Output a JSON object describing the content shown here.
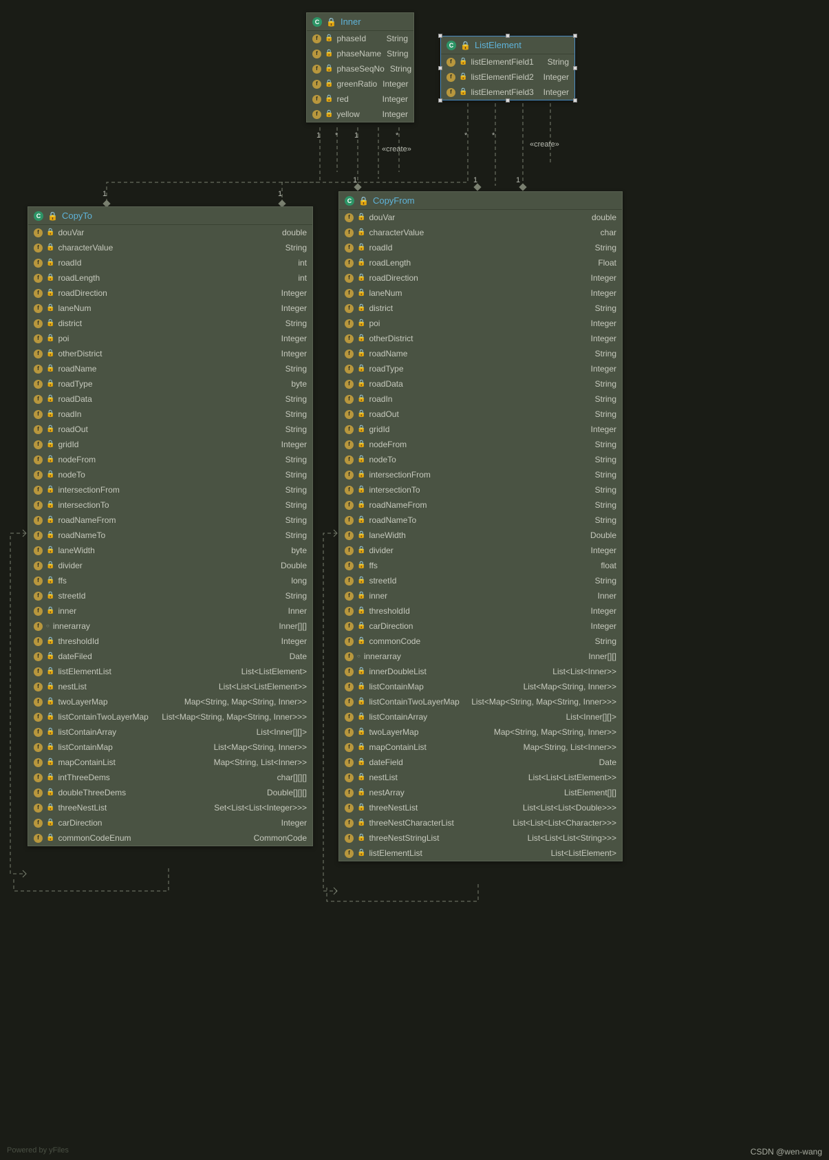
{
  "classes": {
    "inner": {
      "title": "Inner",
      "fields": [
        {
          "name": "phaseId",
          "type": "String",
          "vis": "lock"
        },
        {
          "name": "phaseName",
          "type": "String",
          "vis": "lock"
        },
        {
          "name": "phaseSeqNo",
          "type": "String",
          "vis": "lock"
        },
        {
          "name": "greenRatio",
          "type": "Integer",
          "vis": "lock"
        },
        {
          "name": "red",
          "type": "Integer",
          "vis": "lock"
        },
        {
          "name": "yellow",
          "type": "Integer",
          "vis": "lock"
        }
      ]
    },
    "listElement": {
      "title": "ListElement",
      "fields": [
        {
          "name": "listElementField1",
          "type": "String",
          "vis": "lock"
        },
        {
          "name": "listElementField2",
          "type": "Integer",
          "vis": "lock"
        },
        {
          "name": "listElementField3",
          "type": "Integer",
          "vis": "lock"
        }
      ]
    },
    "copyTo": {
      "title": "CopyTo",
      "fields": [
        {
          "name": "douVar",
          "type": "double",
          "vis": "lock"
        },
        {
          "name": "characterValue",
          "type": "String",
          "vis": "lock"
        },
        {
          "name": "roadId",
          "type": "int",
          "vis": "lock"
        },
        {
          "name": "roadLength",
          "type": "int",
          "vis": "lock"
        },
        {
          "name": "roadDirection",
          "type": "Integer",
          "vis": "lock"
        },
        {
          "name": "laneNum",
          "type": "Integer",
          "vis": "lock"
        },
        {
          "name": "district",
          "type": "String",
          "vis": "lock"
        },
        {
          "name": "poi",
          "type": "Integer",
          "vis": "lock"
        },
        {
          "name": "otherDistrict",
          "type": "Integer",
          "vis": "lock"
        },
        {
          "name": "roadName",
          "type": "String",
          "vis": "lock"
        },
        {
          "name": "roadType",
          "type": "byte",
          "vis": "lock"
        },
        {
          "name": "roadData",
          "type": "String",
          "vis": "lock"
        },
        {
          "name": "roadIn",
          "type": "String",
          "vis": "lock"
        },
        {
          "name": "roadOut",
          "type": "String",
          "vis": "lock"
        },
        {
          "name": "gridId",
          "type": "Integer",
          "vis": "lock"
        },
        {
          "name": "nodeFrom",
          "type": "String",
          "vis": "lock"
        },
        {
          "name": "nodeTo",
          "type": "String",
          "vis": "lock"
        },
        {
          "name": "intersectionFrom",
          "type": "String",
          "vis": "lock"
        },
        {
          "name": "intersectionTo",
          "type": "String",
          "vis": "lock"
        },
        {
          "name": "roadNameFrom",
          "type": "String",
          "vis": "lock"
        },
        {
          "name": "roadNameTo",
          "type": "String",
          "vis": "lock"
        },
        {
          "name": "laneWidth",
          "type": "byte",
          "vis": "lock"
        },
        {
          "name": "divider",
          "type": "Double",
          "vis": "lock"
        },
        {
          "name": "ffs",
          "type": "long",
          "vis": "lock"
        },
        {
          "name": "streetId",
          "type": "String",
          "vis": "lock"
        },
        {
          "name": "inner",
          "type": "Inner",
          "vis": "lock"
        },
        {
          "name": "innerarray",
          "type": "Inner[][]",
          "vis": "circle"
        },
        {
          "name": "thresholdId",
          "type": "Integer",
          "vis": "lock"
        },
        {
          "name": "dateFiled",
          "type": "Date",
          "vis": "lock"
        },
        {
          "name": "listElementList",
          "type": "List<ListElement>",
          "vis": "lock"
        },
        {
          "name": "nestList",
          "type": "List<List<ListElement>>",
          "vis": "lock"
        },
        {
          "name": "twoLayerMap",
          "type": "Map<String, Map<String, Inner>>",
          "vis": "lock"
        },
        {
          "name": "listContainTwoLayerMap",
          "type": "List<Map<String, Map<String, Inner>>>",
          "vis": "lock"
        },
        {
          "name": "listContainArray",
          "type": "List<Inner[][]>",
          "vis": "lock"
        },
        {
          "name": "listContainMap",
          "type": "List<Map<String, Inner>>",
          "vis": "lock"
        },
        {
          "name": "mapContainList",
          "type": "Map<String, List<Inner>>",
          "vis": "lock"
        },
        {
          "name": "intThreeDems",
          "type": "char[][][]",
          "vis": "lock"
        },
        {
          "name": "doubleThreeDems",
          "type": "Double[][][]",
          "vis": "lock"
        },
        {
          "name": "threeNestList",
          "type": "Set<List<List<Integer>>>",
          "vis": "lock"
        },
        {
          "name": "carDirection",
          "type": "Integer",
          "vis": "lock"
        },
        {
          "name": "commonCodeEnum",
          "type": "CommonCode",
          "vis": "lock"
        }
      ]
    },
    "copyFrom": {
      "title": "CopyFrom",
      "fields": [
        {
          "name": "douVar",
          "type": "double",
          "vis": "lock"
        },
        {
          "name": "characterValue",
          "type": "char",
          "vis": "lock"
        },
        {
          "name": "roadId",
          "type": "String",
          "vis": "lock"
        },
        {
          "name": "roadLength",
          "type": "Float",
          "vis": "lock"
        },
        {
          "name": "roadDirection",
          "type": "Integer",
          "vis": "lock"
        },
        {
          "name": "laneNum",
          "type": "Integer",
          "vis": "lock"
        },
        {
          "name": "district",
          "type": "String",
          "vis": "lock"
        },
        {
          "name": "poi",
          "type": "Integer",
          "vis": "lock"
        },
        {
          "name": "otherDistrict",
          "type": "Integer",
          "vis": "lock"
        },
        {
          "name": "roadName",
          "type": "String",
          "vis": "lock"
        },
        {
          "name": "roadType",
          "type": "Integer",
          "vis": "lock"
        },
        {
          "name": "roadData",
          "type": "String",
          "vis": "lock"
        },
        {
          "name": "roadIn",
          "type": "String",
          "vis": "lock"
        },
        {
          "name": "roadOut",
          "type": "String",
          "vis": "lock"
        },
        {
          "name": "gridId",
          "type": "Integer",
          "vis": "lock"
        },
        {
          "name": "nodeFrom",
          "type": "String",
          "vis": "lock"
        },
        {
          "name": "nodeTo",
          "type": "String",
          "vis": "lock"
        },
        {
          "name": "intersectionFrom",
          "type": "String",
          "vis": "lock"
        },
        {
          "name": "intersectionTo",
          "type": "String",
          "vis": "lock"
        },
        {
          "name": "roadNameFrom",
          "type": "String",
          "vis": "lock"
        },
        {
          "name": "roadNameTo",
          "type": "String",
          "vis": "lock"
        },
        {
          "name": "laneWidth",
          "type": "Double",
          "vis": "lock"
        },
        {
          "name": "divider",
          "type": "Integer",
          "vis": "lock"
        },
        {
          "name": "ffs",
          "type": "float",
          "vis": "lock"
        },
        {
          "name": "streetId",
          "type": "String",
          "vis": "lock"
        },
        {
          "name": "inner",
          "type": "Inner",
          "vis": "lock"
        },
        {
          "name": "thresholdId",
          "type": "Integer",
          "vis": "lock"
        },
        {
          "name": "carDirection",
          "type": "Integer",
          "vis": "lock"
        },
        {
          "name": "commonCode",
          "type": "String",
          "vis": "lock"
        },
        {
          "name": "innerarray",
          "type": "Inner[][]",
          "vis": "circle"
        },
        {
          "name": "innerDoubleList",
          "type": "List<List<Inner>>",
          "vis": "lock"
        },
        {
          "name": "listContainMap",
          "type": "List<Map<String, Inner>>",
          "vis": "lock"
        },
        {
          "name": "listContainTwoLayerMap",
          "type": "List<Map<String, Map<String, Inner>>>",
          "vis": "lock"
        },
        {
          "name": "listContainArray",
          "type": "List<Inner[][]>",
          "vis": "lock"
        },
        {
          "name": "twoLayerMap",
          "type": "Map<String, Map<String, Inner>>",
          "vis": "lock"
        },
        {
          "name": "mapContainList",
          "type": "Map<String, List<Inner>>",
          "vis": "lock"
        },
        {
          "name": "dateField",
          "type": "Date",
          "vis": "lock"
        },
        {
          "name": "nestList",
          "type": "List<List<ListElement>>",
          "vis": "lock"
        },
        {
          "name": "nestArray",
          "type": "ListElement[][]",
          "vis": "lock"
        },
        {
          "name": "threeNestList",
          "type": "List<List<List<Double>>>",
          "vis": "lock"
        },
        {
          "name": "threeNestCharacterList",
          "type": "List<List<List<Character>>>",
          "vis": "lock"
        },
        {
          "name": "threeNestStringList",
          "type": "List<List<List<String>>>",
          "vis": "lock"
        },
        {
          "name": "listElementList",
          "type": "List<ListElement>",
          "vis": "lock"
        }
      ]
    }
  },
  "labels": {
    "create1": "«create»",
    "create2": "«create»",
    "one": "1",
    "star": "*"
  },
  "footer": {
    "left": "Powered by yFiles",
    "right": "CSDN @wen-wang"
  }
}
